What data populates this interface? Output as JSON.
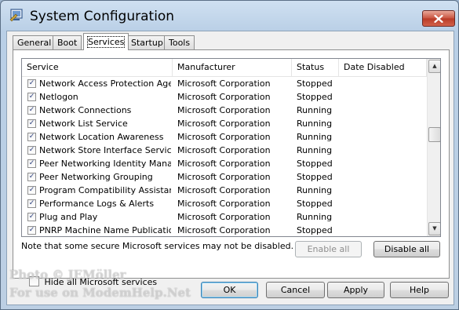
{
  "window": {
    "title": "System Configuration"
  },
  "tabs": [
    {
      "label": "General",
      "active": false
    },
    {
      "label": "Boot",
      "active": false
    },
    {
      "label": "Services",
      "active": true
    },
    {
      "label": "Startup",
      "active": false
    },
    {
      "label": "Tools",
      "active": false
    }
  ],
  "services": {
    "columns": [
      "Service",
      "Manufacturer",
      "Status",
      "Date Disabled"
    ],
    "rows": [
      {
        "checked": true,
        "service": "Network Access Protection Agent",
        "manufacturer": "Microsoft Corporation",
        "status": "Stopped",
        "date_disabled": ""
      },
      {
        "checked": true,
        "service": "Netlogon",
        "manufacturer": "Microsoft Corporation",
        "status": "Stopped",
        "date_disabled": ""
      },
      {
        "checked": true,
        "service": "Network Connections",
        "manufacturer": "Microsoft Corporation",
        "status": "Running",
        "date_disabled": ""
      },
      {
        "checked": true,
        "service": "Network List Service",
        "manufacturer": "Microsoft Corporation",
        "status": "Running",
        "date_disabled": ""
      },
      {
        "checked": true,
        "service": "Network Location Awareness",
        "manufacturer": "Microsoft Corporation",
        "status": "Running",
        "date_disabled": ""
      },
      {
        "checked": true,
        "service": "Network Store Interface Service",
        "manufacturer": "Microsoft Corporation",
        "status": "Running",
        "date_disabled": ""
      },
      {
        "checked": true,
        "service": "Peer Networking Identity Manager",
        "manufacturer": "Microsoft Corporation",
        "status": "Stopped",
        "date_disabled": ""
      },
      {
        "checked": true,
        "service": "Peer Networking Grouping",
        "manufacturer": "Microsoft Corporation",
        "status": "Stopped",
        "date_disabled": ""
      },
      {
        "checked": true,
        "service": "Program Compatibility Assistant ...",
        "manufacturer": "Microsoft Corporation",
        "status": "Running",
        "date_disabled": ""
      },
      {
        "checked": true,
        "service": "Performance Logs & Alerts",
        "manufacturer": "Microsoft Corporation",
        "status": "Stopped",
        "date_disabled": ""
      },
      {
        "checked": true,
        "service": "Plug and Play",
        "manufacturer": "Microsoft Corporation",
        "status": "Running",
        "date_disabled": ""
      },
      {
        "checked": true,
        "service": "PNRP Machine Name Publication ...",
        "manufacturer": "Microsoft Corporation",
        "status": "Stopped",
        "date_disabled": ""
      }
    ],
    "note": "Note that some secure Microsoft services may not be disabled.",
    "enable_all_label": "Enable all",
    "disable_all_label": "Disable all",
    "hide_ms_label": "Hide all Microsoft services",
    "hide_ms_checked": false
  },
  "buttons": {
    "ok": "OK",
    "cancel": "Cancel",
    "apply": "Apply",
    "help": "Help"
  },
  "watermark": {
    "line1": "Photo © JEMöller",
    "line2": "For use on ModemHelp.Net"
  },
  "icons": {
    "app": "msconfig-icon",
    "close": "close-icon",
    "scroll_up": "scroll-up-arrow-icon",
    "scroll_down": "scroll-down-arrow-icon",
    "check": "checkmark-icon"
  }
}
